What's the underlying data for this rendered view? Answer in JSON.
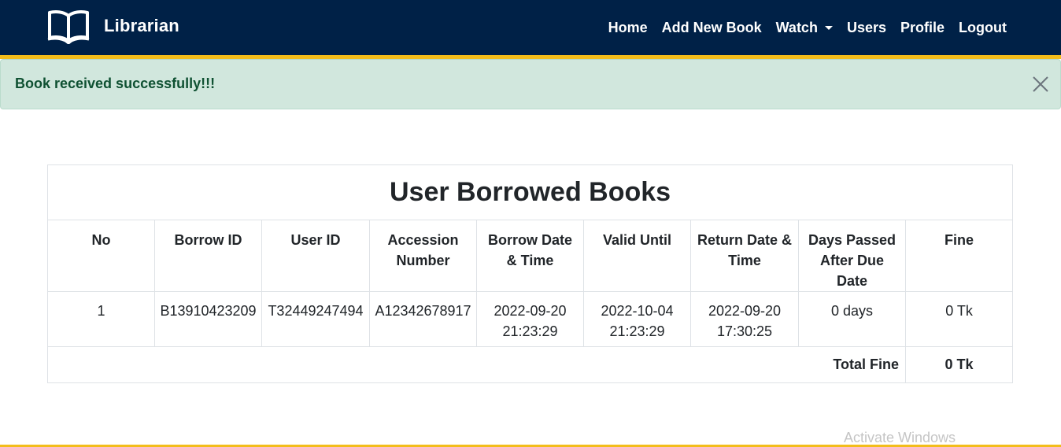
{
  "navbar": {
    "brand": "Librarian",
    "brand_icon": "open-book-icon",
    "links": {
      "home": "Home",
      "add_new_book": "Add New Book",
      "watch": "Watch",
      "users": "Users",
      "profile": "Profile",
      "logout": "Logout"
    },
    "colors": {
      "background": "#002147",
      "accent": "#f3bd1b"
    }
  },
  "alert": {
    "message": "Book received successfully!!!",
    "close_icon": "close-icon",
    "colors": {
      "background": "#d1e7dd",
      "text": "#0f5132"
    }
  },
  "table": {
    "title": "User Borrowed Books",
    "headers": {
      "no": "No",
      "borrow_id": "Borrow ID",
      "user_id": "User ID",
      "accession_number": "Accession Number",
      "borrow_datetime": "Borrow Date & Time",
      "valid_until": "Valid Until",
      "return_datetime": "Return Date & Time",
      "days_passed": "Days Passed After Due Date",
      "fine": "Fine"
    },
    "rows": [
      {
        "no": "1",
        "borrow_id": "B13910423209",
        "user_id": "T32449247494",
        "accession_number": "A12342678917",
        "borrow_datetime": "2022-09-20 21:23:29",
        "valid_until": "2022-10-04 21:23:29",
        "return_datetime": "2022-09-20 17:30:25",
        "days_passed": "0 days",
        "fine": "0 Tk"
      }
    ],
    "total": {
      "label": "Total Fine",
      "value": "0 Tk"
    }
  },
  "watermark": "Activate Windows"
}
